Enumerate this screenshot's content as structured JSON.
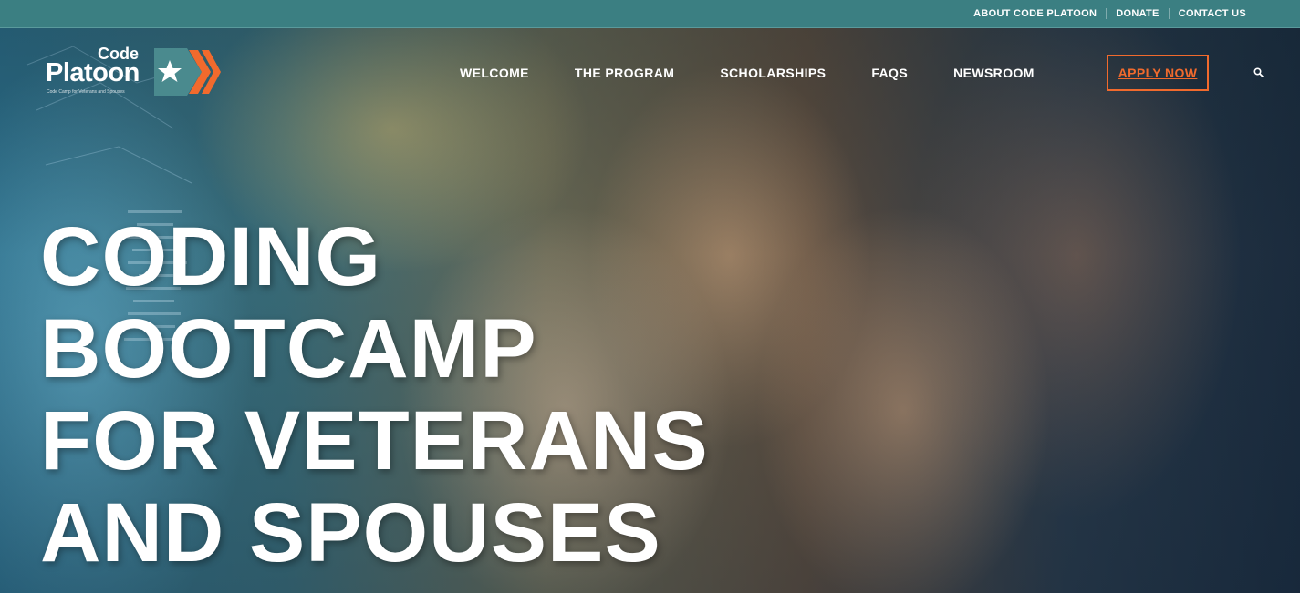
{
  "topbar": {
    "links": [
      "ABOUT CODE PLATOON",
      "DONATE",
      "CONTACT US"
    ]
  },
  "logo": {
    "line1": "Code",
    "line2": "Platoon",
    "tagline": "Code Camp for Veterans and Spouses",
    "icons": [
      "star-icon",
      "chevron-arrows-icon"
    ]
  },
  "nav": {
    "items": [
      "WELCOME",
      "THE PROGRAM",
      "SCHOLARSHIPS",
      "FAQS",
      "NEWSROOM"
    ],
    "cta": "APPLY NOW",
    "search_icon": "search-icon"
  },
  "hero": {
    "headline_lines": [
      "CODING",
      "BOOTCAMP",
      "FOR VETERANS",
      "AND SPOUSES"
    ]
  },
  "colors": {
    "topbar": "#3b7f82",
    "accent": "#f16a2d",
    "logo_teal": "#4a8a8e",
    "text": "#ffffff"
  }
}
